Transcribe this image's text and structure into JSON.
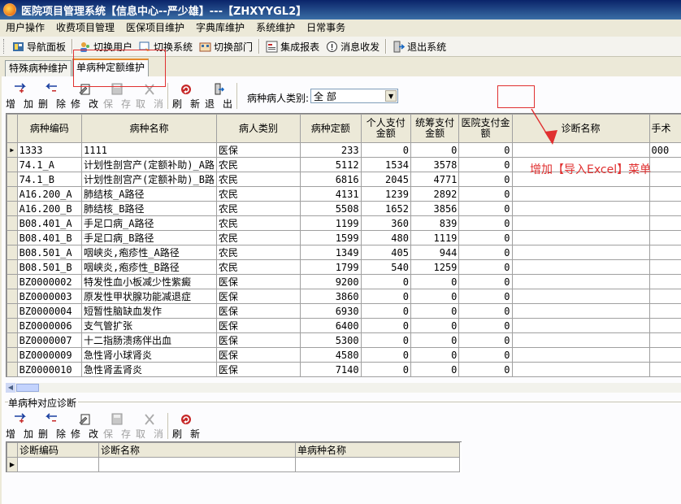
{
  "window": {
    "title": "医院项目管理系统【信息中心--严少雄】---【ZHXYYGL2】"
  },
  "menu": [
    "用户操作",
    "收费项目管理",
    "医保项目维护",
    "字典库维护",
    "系统维护",
    "日常事务"
  ],
  "toolbar": [
    {
      "label": "导航面板",
      "icon": "navigation-panel-icon"
    },
    {
      "label": "切换用户",
      "icon": "switch-user-icon"
    },
    {
      "label": "切换系统",
      "icon": "switch-system-icon"
    },
    {
      "label": "切换部门",
      "icon": "switch-department-icon"
    },
    {
      "label": "集成报表",
      "icon": "report-icon"
    },
    {
      "label": "消息收发",
      "icon": "message-icon"
    },
    {
      "label": "退出系统",
      "icon": "exit-icon"
    }
  ],
  "tabs": [
    "特殊病种维护",
    "单病种定额维护"
  ],
  "actions": [
    {
      "c1": "增",
      "c2": "加",
      "icon": "add-icon",
      "disabled": false
    },
    {
      "c1": "删",
      "c2": "除",
      "icon": "delete-icon",
      "disabled": false
    },
    {
      "c1": "修",
      "c2": "改",
      "icon": "edit-icon",
      "disabled": false
    },
    {
      "c1": "保",
      "c2": "存",
      "icon": "save-icon",
      "disabled": true
    },
    {
      "c1": "取",
      "c2": "消",
      "icon": "cancel-icon",
      "disabled": true
    },
    {
      "c1": "刷",
      "c2": "新",
      "icon": "refresh-icon",
      "disabled": false
    },
    {
      "c1": "退",
      "c2": "出",
      "icon": "exit-icon",
      "disabled": false
    }
  ],
  "filter": {
    "label": "病种病人类别:",
    "value": "全 部"
  },
  "grid": {
    "columns": [
      "病种编码",
      "病种名称",
      "病人类别",
      "病种定额",
      "个人支付金额",
      "统筹支付金额",
      "医院支付金额",
      "诊断名称",
      "手术"
    ],
    "rows": [
      [
        "1333",
        "1111",
        "医保",
        "233",
        "0",
        "0",
        "0",
        "",
        "000"
      ],
      [
        "74.1_A",
        "计划性剖宫产(定额补助)_A路",
        "农民",
        "5112",
        "1534",
        "3578",
        "0",
        "",
        ""
      ],
      [
        "74.1_B",
        "计划性剖宫产(定额补助)_B路",
        "农民",
        "6816",
        "2045",
        "4771",
        "0",
        "",
        ""
      ],
      [
        "A16.200_A",
        "肺结核_A路径",
        "农民",
        "4131",
        "1239",
        "2892",
        "0",
        "",
        ""
      ],
      [
        "A16.200_B",
        "肺结核_B路径",
        "农民",
        "5508",
        "1652",
        "3856",
        "0",
        "",
        ""
      ],
      [
        "B08.401_A",
        "手足口病_A路径",
        "农民",
        "1199",
        "360",
        "839",
        "0",
        "",
        ""
      ],
      [
        "B08.401_B",
        "手足口病_B路径",
        "农民",
        "1599",
        "480",
        "1119",
        "0",
        "",
        ""
      ],
      [
        "B08.501_A",
        "咽峡炎,疱疹性_A路径",
        "农民",
        "1349",
        "405",
        "944",
        "0",
        "",
        ""
      ],
      [
        "B08.501_B",
        "咽峡炎,疱疹性_B路径",
        "农民",
        "1799",
        "540",
        "1259",
        "0",
        "",
        ""
      ],
      [
        "BZ0000002",
        "特发性血小板减少性紫癜",
        "医保",
        "9200",
        "0",
        "0",
        "0",
        "",
        ""
      ],
      [
        "BZ0000003",
        "原发性甲状腺功能减退症",
        "医保",
        "3860",
        "0",
        "0",
        "0",
        "",
        ""
      ],
      [
        "BZ0000004",
        "短暂性脑缺血发作",
        "医保",
        "6930",
        "0",
        "0",
        "0",
        "",
        ""
      ],
      [
        "BZ0000006",
        "支气管扩张",
        "医保",
        "6400",
        "0",
        "0",
        "0",
        "",
        ""
      ],
      [
        "BZ0000007",
        "十二指肠溃疡伴出血",
        "医保",
        "5300",
        "0",
        "0",
        "0",
        "",
        ""
      ],
      [
        "BZ0000009",
        "急性肾小球肾炎",
        "医保",
        "4580",
        "0",
        "0",
        "0",
        "",
        ""
      ],
      [
        "BZ0000010",
        "急性肾盂肾炎",
        "医保",
        "7140",
        "0",
        "0",
        "0",
        "",
        ""
      ]
    ]
  },
  "section": {
    "title": "单病种对应诊断"
  },
  "actions2": [
    {
      "c1": "增",
      "c2": "加",
      "icon": "add-icon",
      "disabled": false
    },
    {
      "c1": "删",
      "c2": "除",
      "icon": "delete-icon",
      "disabled": false
    },
    {
      "c1": "修",
      "c2": "改",
      "icon": "edit-icon",
      "disabled": false
    },
    {
      "c1": "保",
      "c2": "存",
      "icon": "save-icon",
      "disabled": true
    },
    {
      "c1": "取",
      "c2": "消",
      "icon": "cancel-icon",
      "disabled": true
    },
    {
      "c1": "刷",
      "c2": "新",
      "icon": "refresh-icon",
      "disabled": false
    }
  ],
  "grid2": {
    "columns": [
      "诊断编码",
      "诊断名称",
      "单病种名称"
    ]
  },
  "annotation": {
    "text": "增加【导入Excel】菜单",
    "color": "#e03030"
  },
  "colors": {
    "title_bar": "#0a246a",
    "tab_accent": "#e68b2c",
    "face": "#ece9d8"
  }
}
